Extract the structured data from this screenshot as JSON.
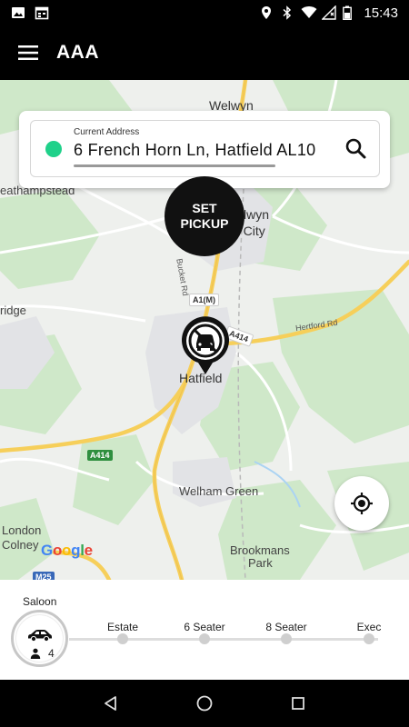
{
  "status_bar": {
    "time": "15:43",
    "left_icons": [
      "image-icon",
      "calendar-icon"
    ],
    "right_icons": [
      "location-icon",
      "bluetooth-icon",
      "wifi-icon",
      "signal-off-icon",
      "battery-icon"
    ]
  },
  "app_bar": {
    "title": "AAA",
    "menu_icon": "menu-icon"
  },
  "address": {
    "label": "Current Address",
    "value": "6 French Horn Ln, Hatfield AL10"
  },
  "set_pickup": {
    "line1": "SET",
    "line2": "PICKUP"
  },
  "map": {
    "labels": {
      "welwyn": "Welwyn",
      "wheathampstead": "eathampstead",
      "welwyn_gc_1": "lwyn",
      "welwyn_gc_2": "n City",
      "bridge": "ridge",
      "hatfield": "Hatfield",
      "welham_green": "Welham Green",
      "london_colney_1": "London",
      "london_colney_2": "Colney",
      "brookmans_1": "Brookmans",
      "brookmans_2": "Park",
      "bucket_rd": "Bucket Rd",
      "hertford_rd": "Hertford Rd"
    },
    "badges": {
      "a1m": "A1(M)",
      "a414_a": "A414",
      "a414_b": "A414",
      "m25": "M25"
    },
    "attribution": "Google"
  },
  "vehicles": {
    "selected": {
      "label": "Saloon",
      "passengers": "4"
    },
    "options": [
      {
        "label": "Estate"
      },
      {
        "label": "6 Seater"
      },
      {
        "label": "8 Seater"
      },
      {
        "label": "Exec"
      }
    ]
  },
  "nav_bar": {
    "icons": [
      "back-icon",
      "home-icon",
      "recents-icon"
    ]
  },
  "colors": {
    "accent_green": "#1fd18a",
    "bar_black": "#000000",
    "road_yellow": "#f6cf5a"
  }
}
